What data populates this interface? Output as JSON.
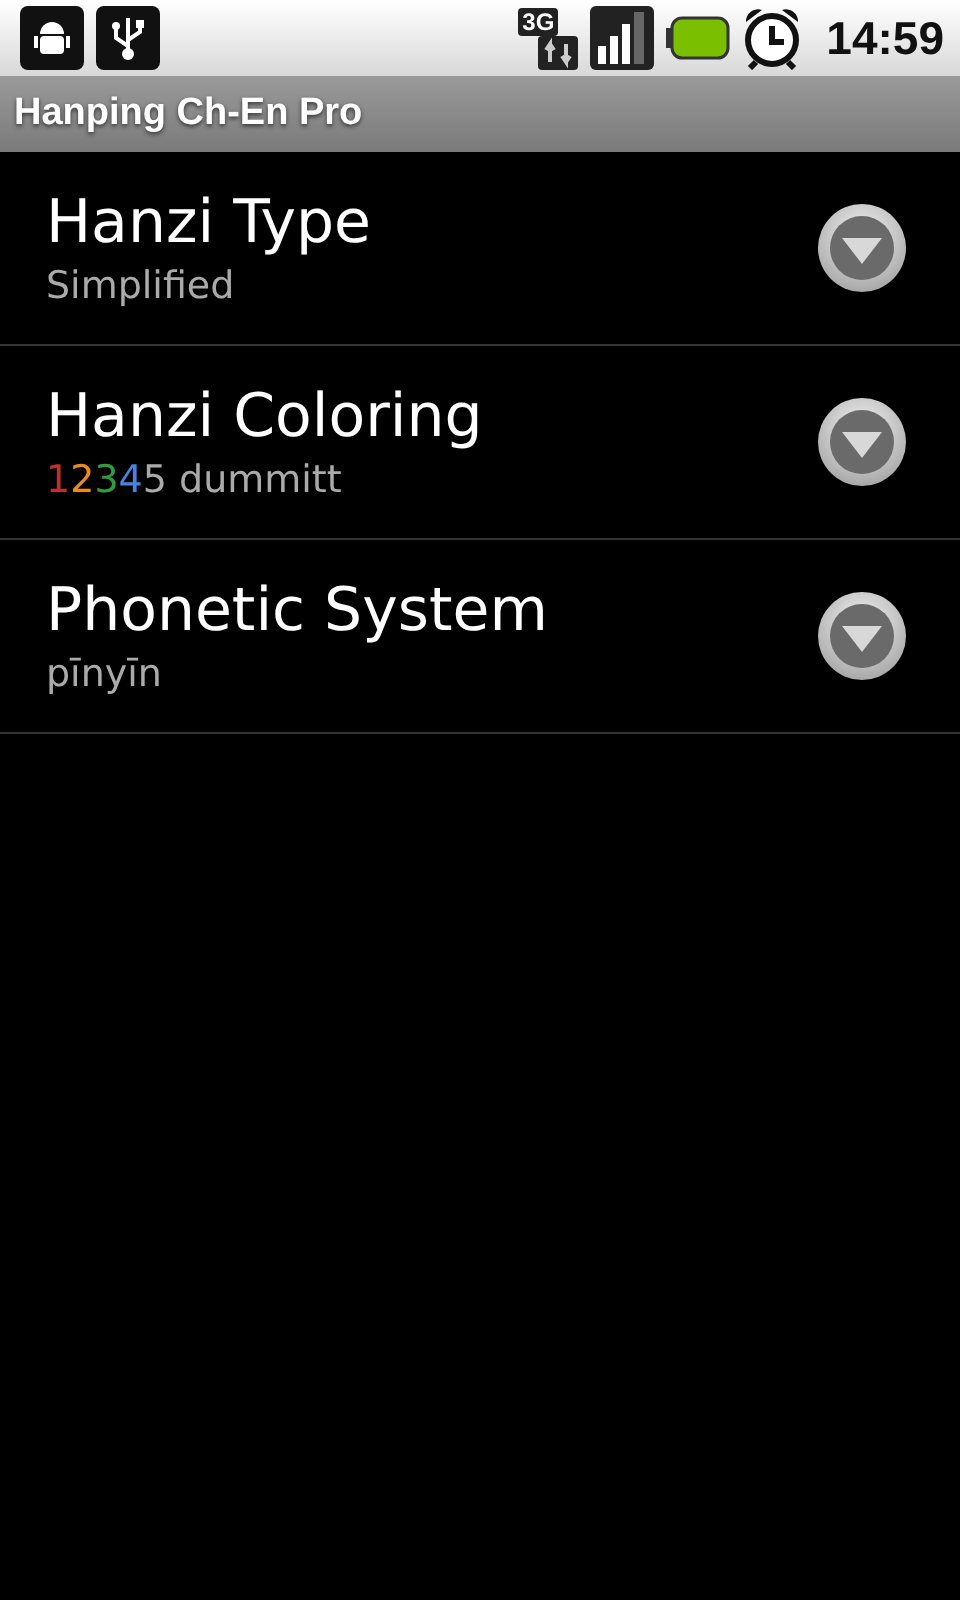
{
  "status_bar": {
    "network_type": "3G",
    "time": "14:59"
  },
  "title_bar": {
    "title": "Hanping Ch-En Pro"
  },
  "preferences": [
    {
      "title": "Hanzi Type",
      "summary_parts": [
        {
          "text": "Simplified",
          "color": "#aaaaaa"
        }
      ]
    },
    {
      "title": "Hanzi Coloring",
      "summary_parts": [
        {
          "text": "1",
          "color": "#c03030"
        },
        {
          "text": "2",
          "color": "#f08a1c"
        },
        {
          "text": "3",
          "color": "#2e9e3a"
        },
        {
          "text": "4",
          "color": "#4a82e0"
        },
        {
          "text": "5 dummitt",
          "color": "#aaaaaa"
        }
      ]
    },
    {
      "title": "Phonetic System",
      "summary_parts": [
        {
          "text": "pīnyīn",
          "color": "#aaaaaa"
        }
      ]
    }
  ]
}
